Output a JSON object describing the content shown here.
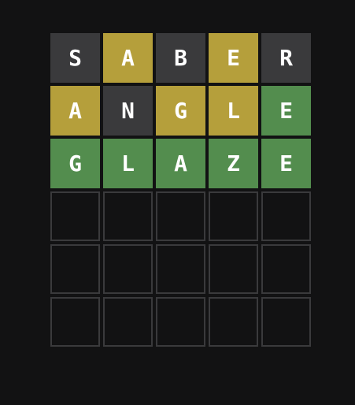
{
  "colors": {
    "absent": "#3a3a3c",
    "present": "#b59f3b",
    "correct": "#538d4e",
    "empty_border": "#3a3a3c",
    "background": "#121213"
  },
  "board": {
    "rows": [
      {
        "tiles": [
          {
            "letter": "S",
            "state": "absent"
          },
          {
            "letter": "A",
            "state": "present"
          },
          {
            "letter": "B",
            "state": "absent"
          },
          {
            "letter": "E",
            "state": "present"
          },
          {
            "letter": "R",
            "state": "absent"
          }
        ]
      },
      {
        "tiles": [
          {
            "letter": "A",
            "state": "present"
          },
          {
            "letter": "N",
            "state": "absent"
          },
          {
            "letter": "G",
            "state": "present"
          },
          {
            "letter": "L",
            "state": "present"
          },
          {
            "letter": "E",
            "state": "correct"
          }
        ]
      },
      {
        "tiles": [
          {
            "letter": "G",
            "state": "correct"
          },
          {
            "letter": "L",
            "state": "correct"
          },
          {
            "letter": "A",
            "state": "correct"
          },
          {
            "letter": "Z",
            "state": "correct"
          },
          {
            "letter": "E",
            "state": "correct"
          }
        ]
      },
      {
        "tiles": [
          {
            "letter": "",
            "state": "empty"
          },
          {
            "letter": "",
            "state": "empty"
          },
          {
            "letter": "",
            "state": "empty"
          },
          {
            "letter": "",
            "state": "empty"
          },
          {
            "letter": "",
            "state": "empty"
          }
        ]
      },
      {
        "tiles": [
          {
            "letter": "",
            "state": "empty"
          },
          {
            "letter": "",
            "state": "empty"
          },
          {
            "letter": "",
            "state": "empty"
          },
          {
            "letter": "",
            "state": "empty"
          },
          {
            "letter": "",
            "state": "empty"
          }
        ]
      },
      {
        "tiles": [
          {
            "letter": "",
            "state": "empty"
          },
          {
            "letter": "",
            "state": "empty"
          },
          {
            "letter": "",
            "state": "empty"
          },
          {
            "letter": "",
            "state": "empty"
          },
          {
            "letter": "",
            "state": "empty"
          }
        ]
      }
    ]
  }
}
